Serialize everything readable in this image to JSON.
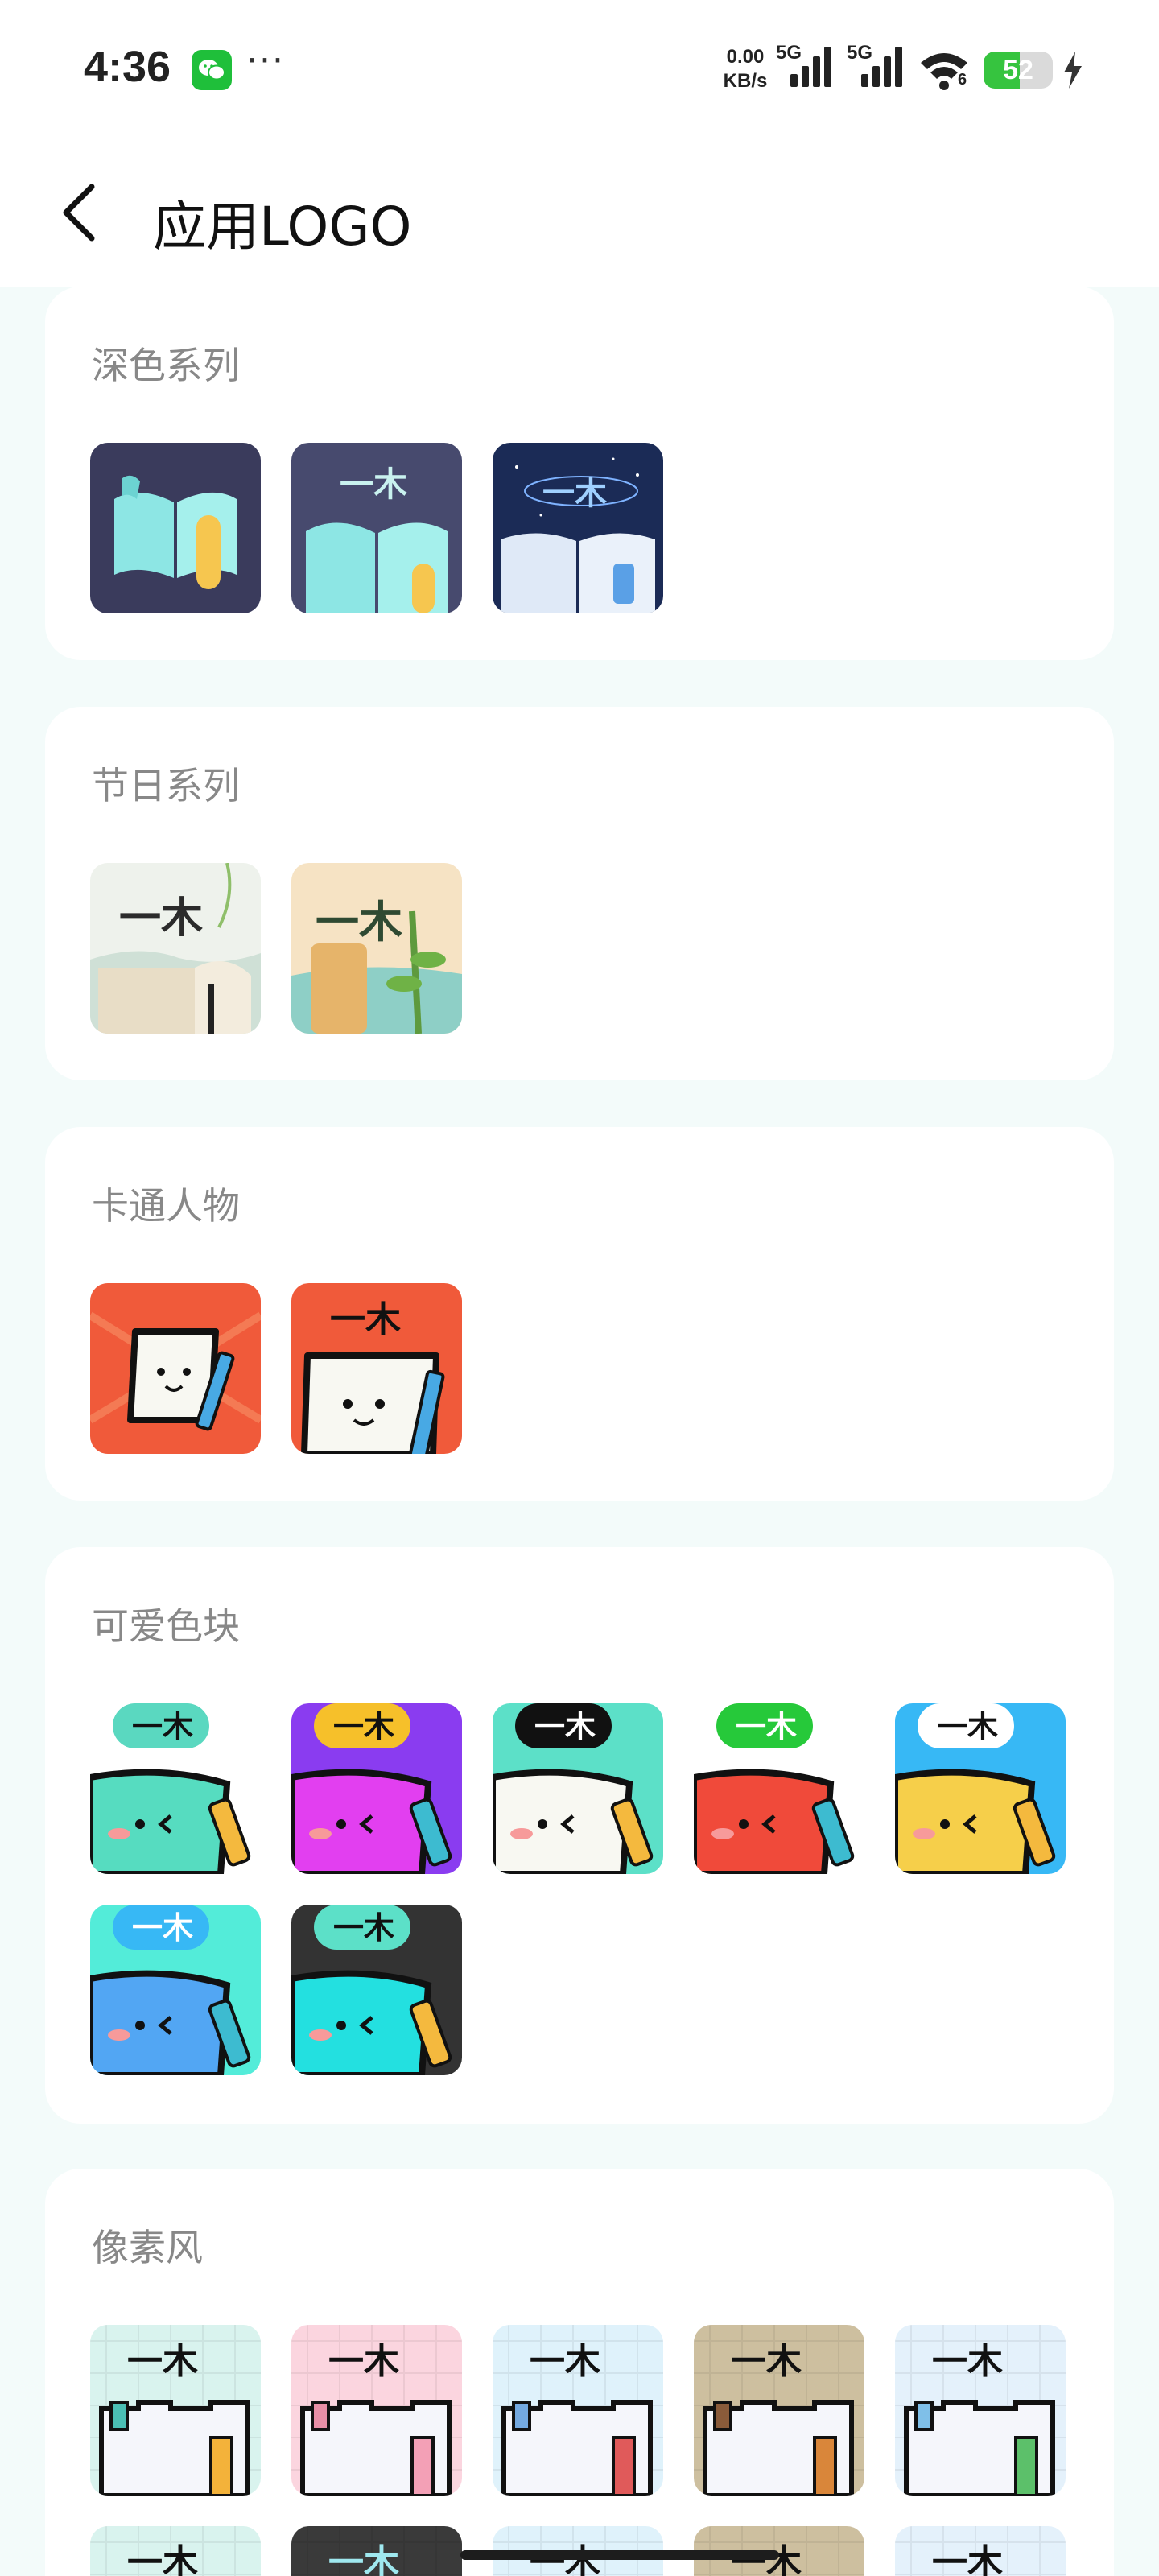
{
  "status_bar": {
    "time": "4:36",
    "more": "···",
    "net_speed_value": "0.00",
    "net_speed_unit": "KB/s",
    "sim1_label": "5G",
    "sim2_label": "5G",
    "wifi_label": "6",
    "battery_level": "52",
    "battery_fraction": 0.52
  },
  "header": {
    "title": "应用LOGO"
  },
  "sections": [
    {
      "title": "深色系列"
    },
    {
      "title": "节日系列"
    },
    {
      "title": "卡通人物"
    },
    {
      "title": "可爱色块"
    },
    {
      "title": "像素风"
    }
  ],
  "logo_text": "一木",
  "colors": {
    "accent_green": "#1fbf3a",
    "page_background": "#f3fbfa",
    "card_background": "#ffffff",
    "section_title": "#888888",
    "cartoon_red": "#f05a3a",
    "cute_blocks": [
      "#56dcc0",
      "#e23ff0",
      "#5ce0c8",
      "#f04a3a",
      "#37b8f5",
      "#53ecd9",
      "#333333"
    ],
    "pixel_bg": [
      "#d9f3ee",
      "#fbd5df",
      "#dff2fb",
      "#cdbf9f",
      "#e4f1fb"
    ]
  }
}
